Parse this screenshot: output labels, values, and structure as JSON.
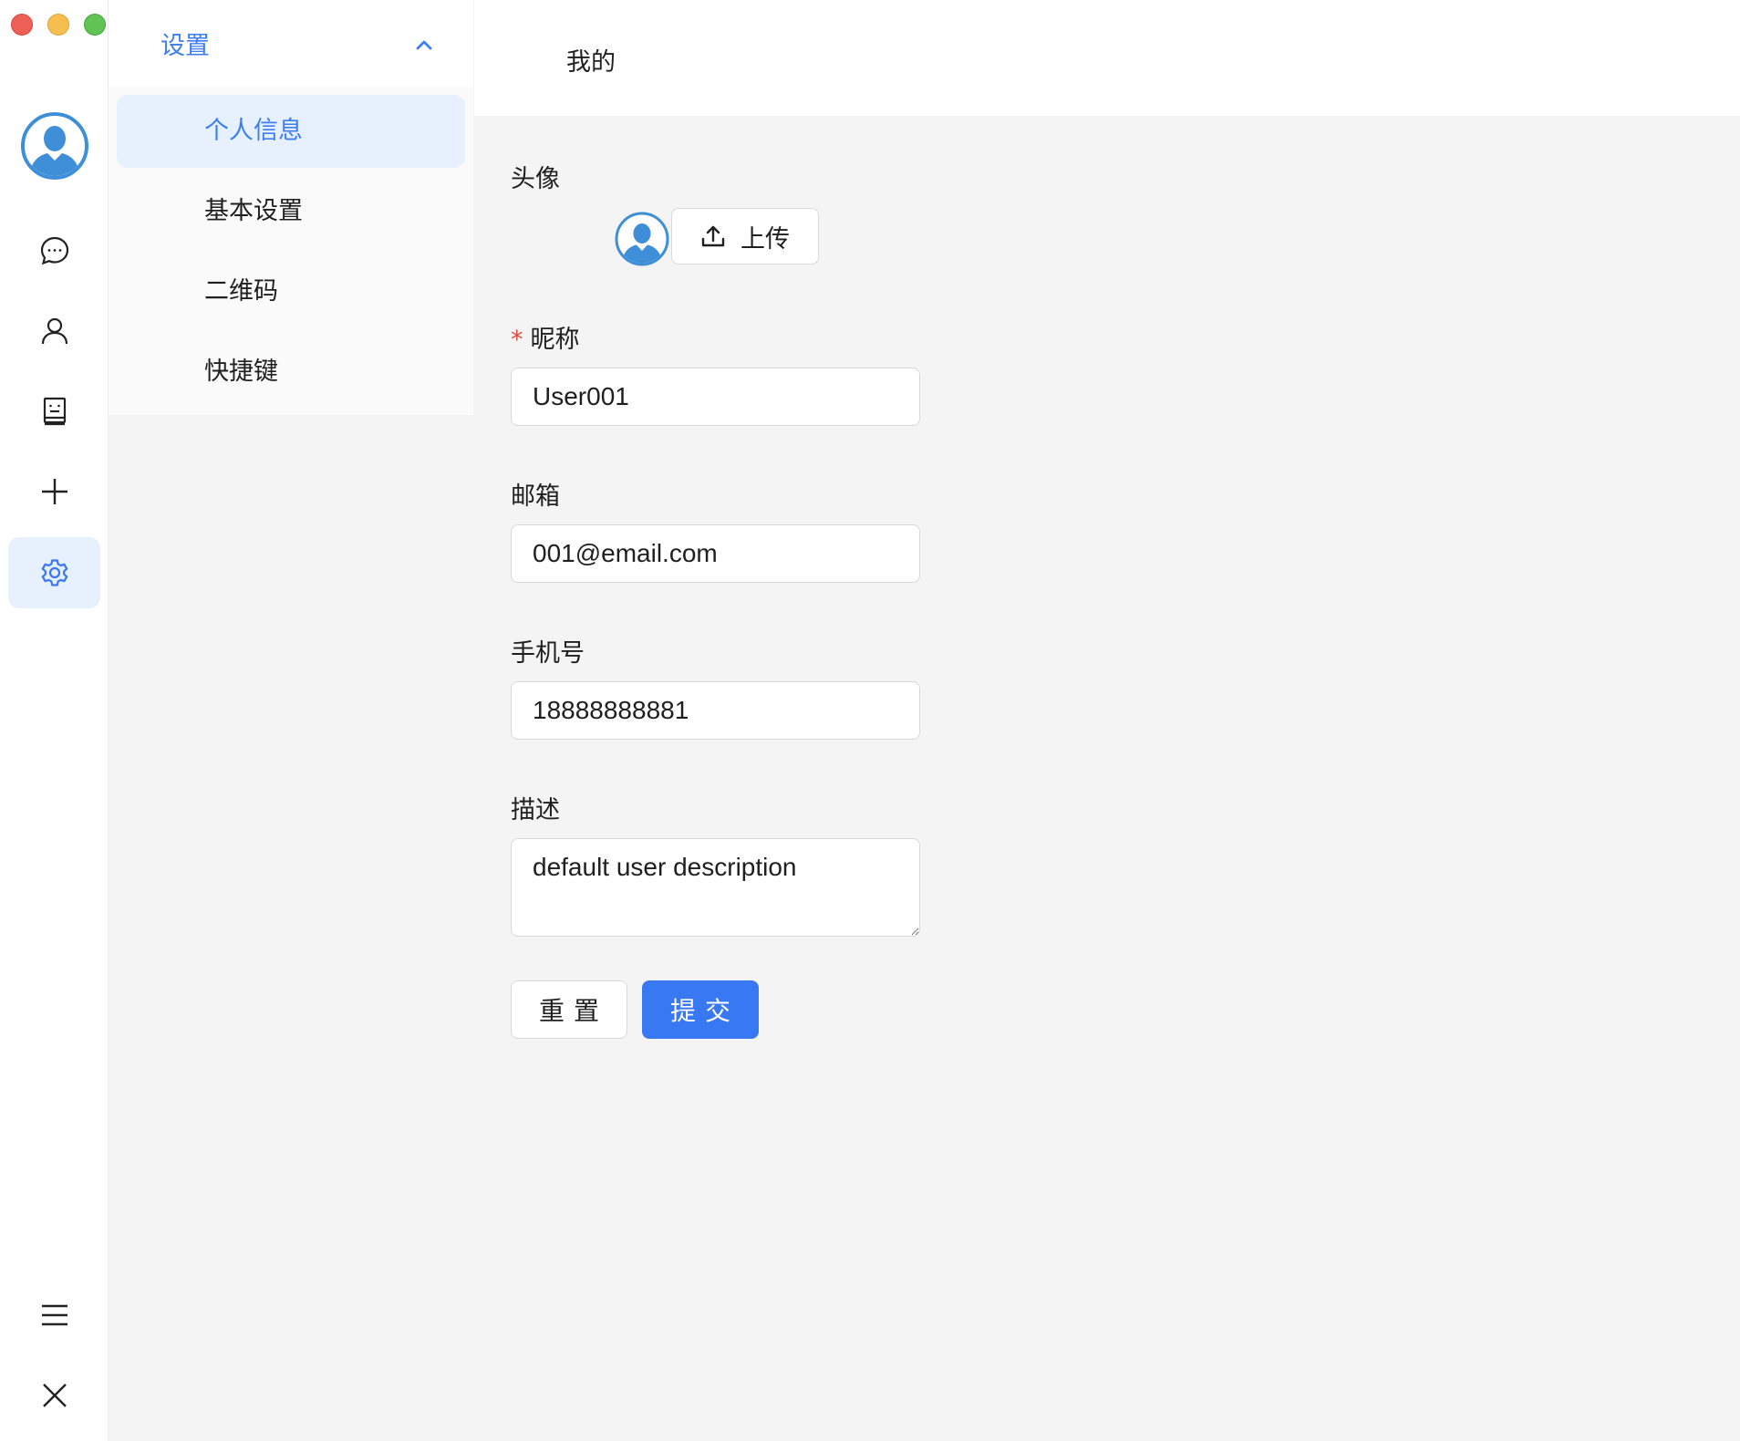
{
  "window": {
    "traffic_lights": [
      "close",
      "minimize",
      "zoom"
    ]
  },
  "rail": {
    "items": [
      {
        "icon": "chat-icon",
        "active": false
      },
      {
        "icon": "user-icon",
        "active": false
      },
      {
        "icon": "contacts-book-icon",
        "active": false
      },
      {
        "icon": "plus-icon",
        "active": false
      },
      {
        "icon": "gear-icon",
        "active": true
      }
    ],
    "bottom": [
      {
        "icon": "menu-icon"
      },
      {
        "icon": "close-icon"
      }
    ]
  },
  "submenu": {
    "title": "设置",
    "items": [
      {
        "label": "个人信息",
        "active": true
      },
      {
        "label": "基本设置",
        "active": false
      },
      {
        "label": "二维码",
        "active": false
      },
      {
        "label": "快捷键",
        "active": false
      }
    ]
  },
  "main": {
    "title": "我的",
    "form": {
      "avatar_label": "头像",
      "upload_label": "上传",
      "nickname_required": "*",
      "nickname_label": "昵称",
      "nickname_value": "User001",
      "email_label": "邮箱",
      "email_value": "001@email.com",
      "phone_label": "手机号",
      "phone_value": "18888888881",
      "description_label": "描述",
      "description_value": "default user description",
      "reset_label": "重置",
      "submit_label": "提交"
    }
  },
  "colors": {
    "accent": "#3878f3",
    "active_bg": "#e7f0fd",
    "required": "#e5483d"
  }
}
